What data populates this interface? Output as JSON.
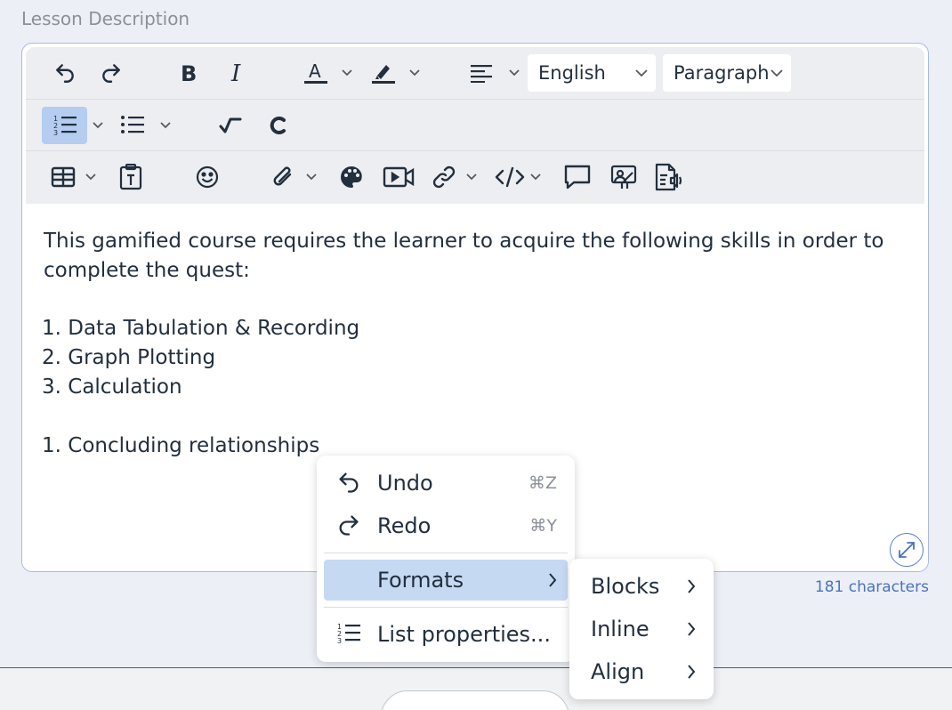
{
  "field": {
    "label": "Lesson Description"
  },
  "toolbar": {
    "language_select": "English",
    "block_select": "Paragraph",
    "text_color": "#222f3e",
    "highlight_color": "#222f3e"
  },
  "content": {
    "paragraph": "This gamified course requires the learner to acquire the following skills in order to complete the quest:",
    "list1": [
      "1. Data Tabulation & Recording",
      "2. Graph Plotting",
      "3. Calculation"
    ],
    "list2": [
      "1. Concluding relationships"
    ]
  },
  "char_count": "181 characters",
  "context_menu": {
    "undo_label": "Undo",
    "undo_shortcut": "⌘Z",
    "redo_label": "Redo",
    "redo_shortcut": "⌘Y",
    "formats_label": "Formats",
    "list_properties_label": "List properties..."
  },
  "formats_submenu": {
    "blocks_label": "Blocks",
    "inline_label": "Inline",
    "align_label": "Align"
  },
  "colors": {
    "accent": "#b4cdf0",
    "menu_highlight": "#c6d9f3",
    "border": "#a8bbe4",
    "link": "#4a72c2"
  }
}
